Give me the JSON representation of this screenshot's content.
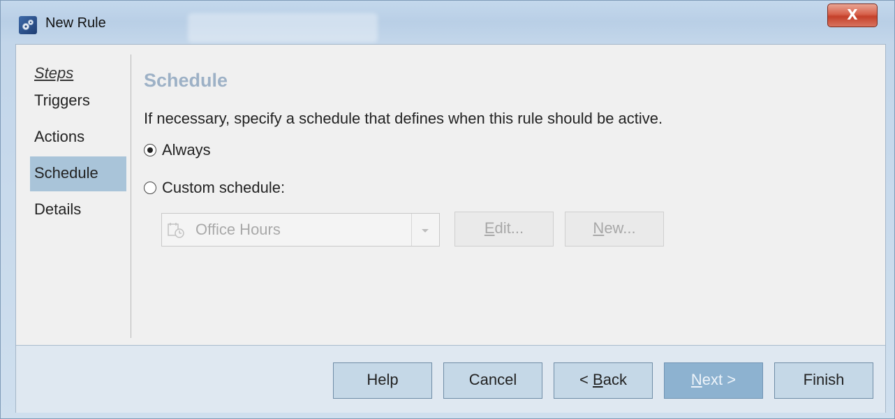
{
  "window": {
    "title": "New Rule",
    "close_label": "X"
  },
  "steps": {
    "header": "Steps",
    "items": [
      {
        "label": "Triggers",
        "active": false
      },
      {
        "label": "Actions",
        "active": false
      },
      {
        "label": "Schedule",
        "active": true
      },
      {
        "label": "Details",
        "active": false
      }
    ]
  },
  "content": {
    "title": "Schedule",
    "description": "If necessary, specify a schedule that defines when this rule should be active.",
    "options": [
      {
        "label": "Always",
        "selected": true
      },
      {
        "label": "Custom schedule:",
        "selected": false
      }
    ],
    "schedule_select": {
      "value": "Office Hours",
      "enabled": false
    },
    "edit_button": {
      "mnemonic": "E",
      "rest": "dit..."
    },
    "new_button": {
      "mnemonic": "N",
      "rest": "ew..."
    }
  },
  "footer": {
    "help": "Help",
    "cancel": "Cancel",
    "back": {
      "prefix": "< ",
      "mnemonic": "B",
      "rest": "ack"
    },
    "next": {
      "mnemonic": "N",
      "rest": "ext >"
    },
    "finish": "Finish"
  },
  "colors": {
    "active_step_bg": "#a9c4d9",
    "primary_button_bg": "#8db2d0",
    "section_title": "#9db1c6",
    "close_button": "#c4402a"
  }
}
